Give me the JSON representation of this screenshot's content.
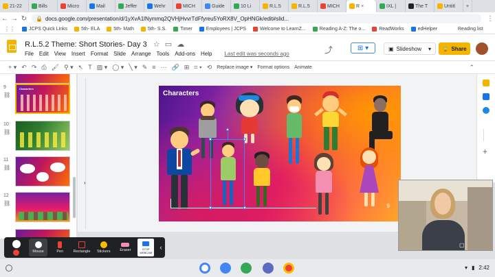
{
  "browser": {
    "tabs": [
      {
        "label": "21-22",
        "color": "#f4b400"
      },
      {
        "label": "Bills",
        "color": "#34a853"
      },
      {
        "label": "Micro",
        "color": "#ea4335"
      },
      {
        "label": "Mail",
        "color": "#1a73e8"
      },
      {
        "label": "Jeffer",
        "color": "#34a853"
      },
      {
        "label": "Wehr",
        "color": "#1a73e8"
      },
      {
        "label": "MICH",
        "color": "#ea4335"
      },
      {
        "label": "Guide",
        "color": "#4285f4"
      },
      {
        "label": "10 Li",
        "color": "#34a853"
      },
      {
        "label": "R.L.5",
        "color": "#f4b400"
      },
      {
        "label": "R.L.5",
        "color": "#f4b400"
      },
      {
        "label": "MICH",
        "color": "#ea4335"
      },
      {
        "label": "R",
        "color": "#f4b400",
        "active": true
      },
      {
        "label": "IXL |",
        "color": "#34a853"
      },
      {
        "label": "The T",
        "color": "#202124"
      },
      {
        "label": "Untitl",
        "color": "#f4b400"
      }
    ],
    "url": "docs.google.com/presentation/d/1yXvA1lNymmq2QVHjHvvrTdFfyreu5YoRX8V_OpHNGk/edit#slid...",
    "bookmarks": [
      {
        "label": "JCPS Quick Links",
        "color": "#1a73e8"
      },
      {
        "label": "5th- ELA",
        "color": "#f4b400"
      },
      {
        "label": "5th- Math",
        "color": "#f4b400"
      },
      {
        "label": "5th- S.S.",
        "color": "#f4b400"
      },
      {
        "label": "Timer",
        "color": "#34a853"
      },
      {
        "label": "Employees | JCPS",
        "color": "#1a73e8"
      },
      {
        "label": "Welcome to LearnZ...",
        "color": "#ea4335"
      },
      {
        "label": "Reading A-Z: The o...",
        "color": "#34a853"
      },
      {
        "label": "ReadWorks",
        "color": "#ea4335"
      },
      {
        "label": "edHelper",
        "color": "#1a73e8"
      }
    ],
    "reading_list": "Reading list"
  },
  "doc": {
    "title": "R.L.5.2 Theme: Short Stories- Day 3",
    "menu": [
      "File",
      "Edit",
      "View",
      "Insert",
      "Format",
      "Slide",
      "Arrange",
      "Tools",
      "Add-ons",
      "Help"
    ],
    "last_edit": "Last edit was seconds ago",
    "slideshow_label": "Slideshow",
    "share_label": "Share"
  },
  "toolbar": {
    "replace_image": "Replace image",
    "format_options": "Format options",
    "animate": "Animate"
  },
  "filmstrip": {
    "numbers": [
      "9",
      "10",
      "11",
      "12"
    ]
  },
  "slide": {
    "title": "Characters",
    "number": "9"
  },
  "screencast": {
    "buttons": [
      "Mouse",
      "Pen",
      "Rectangle",
      "Stickers",
      "Eraser"
    ],
    "stop_label": "STOP WEBCAM"
  },
  "shelf": {
    "time": "2:42"
  }
}
